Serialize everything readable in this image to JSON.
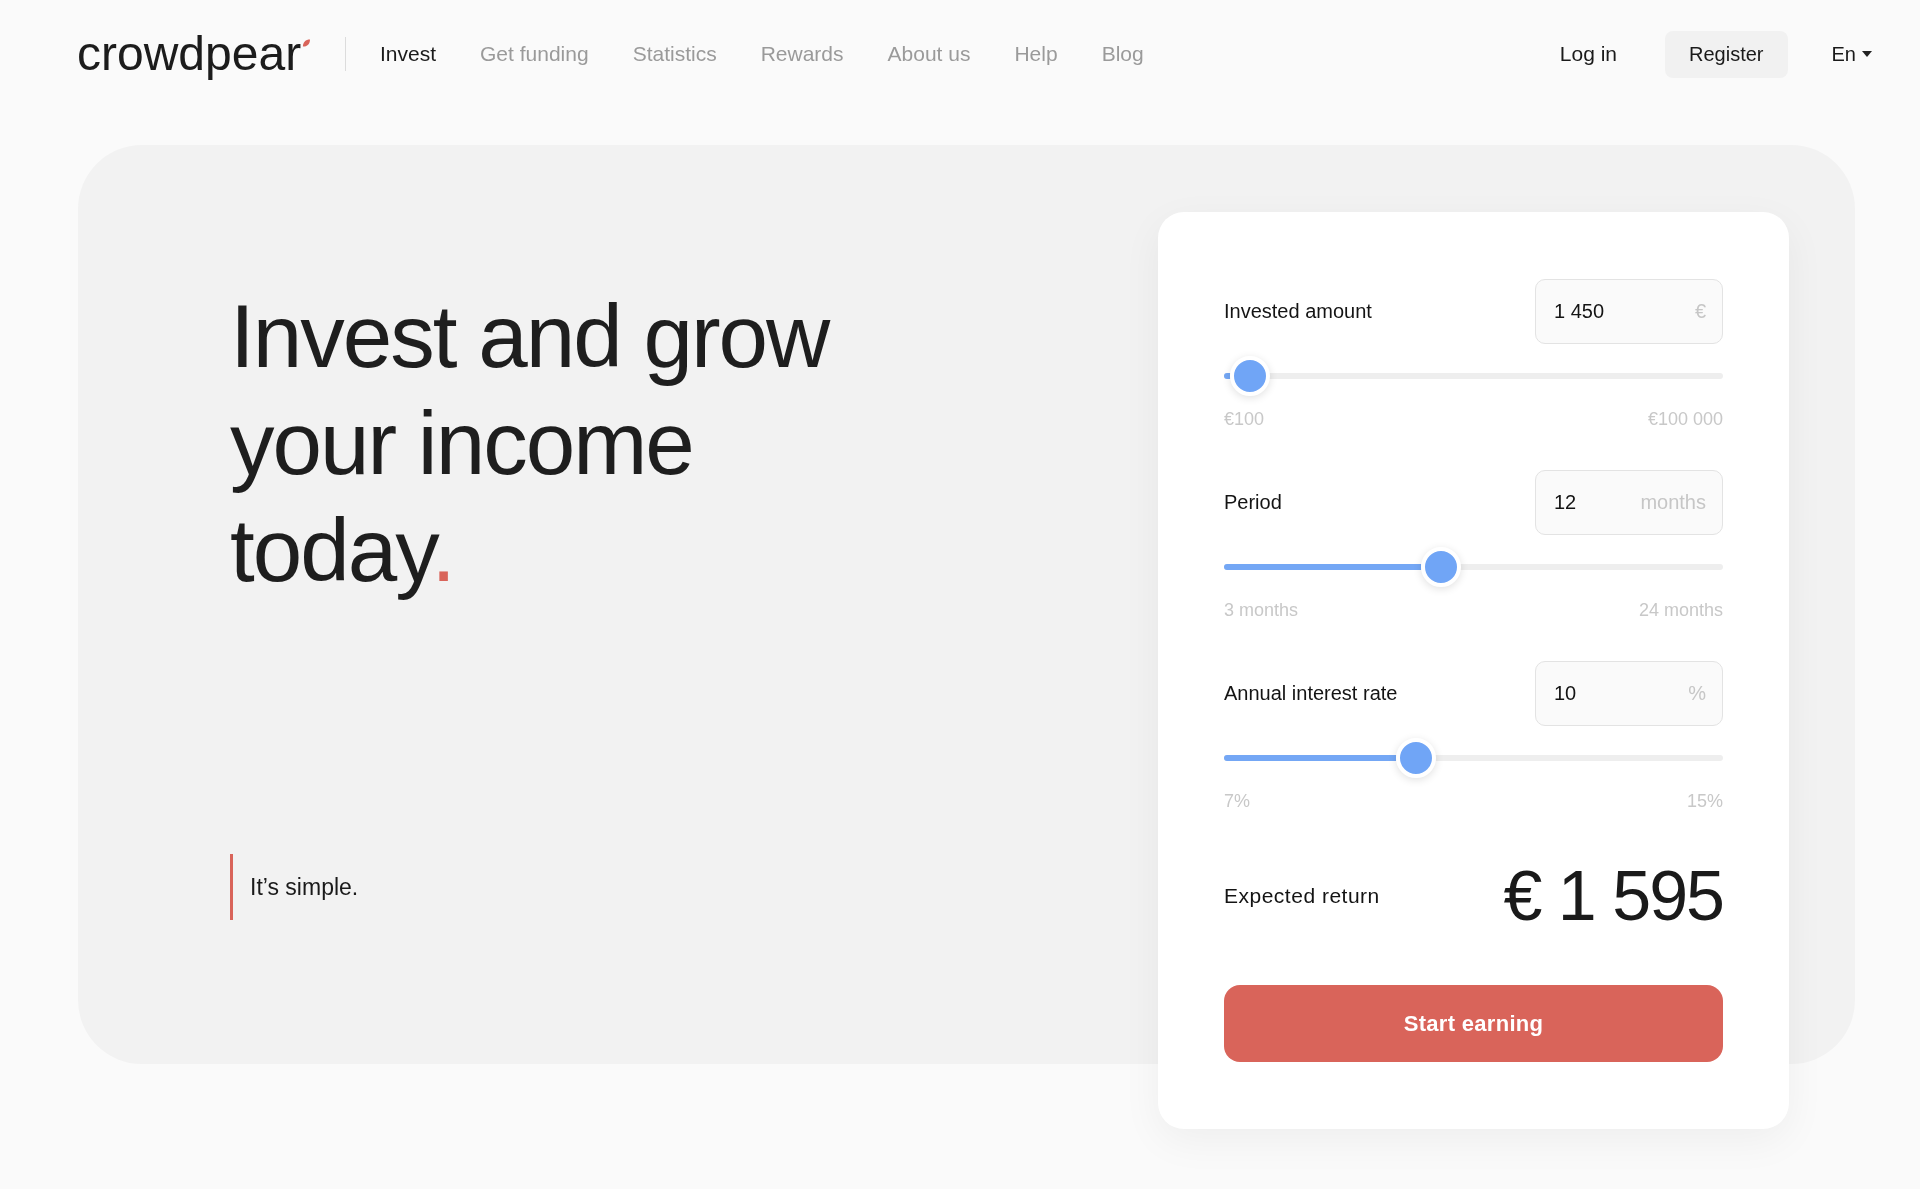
{
  "header": {
    "logo": "crowdpear",
    "nav": [
      {
        "label": "Invest",
        "selected": true
      },
      {
        "label": "Get funding",
        "selected": false
      },
      {
        "label": "Statistics",
        "selected": false
      },
      {
        "label": "Rewards",
        "selected": false
      },
      {
        "label": "About us",
        "selected": false
      },
      {
        "label": "Help",
        "selected": false
      },
      {
        "label": "Blog",
        "selected": false
      }
    ],
    "login": "Log in",
    "register": "Register",
    "language": "En"
  },
  "hero": {
    "headline": "Invest and grow your income today",
    "headline_end": ".",
    "tagline": "It’s simple."
  },
  "calculator": {
    "fields": [
      {
        "label": "Invested amount",
        "value": "1 450",
        "unit": "€",
        "level": 0.014,
        "min_label": "€100",
        "max_label": "€100 000"
      },
      {
        "label": "Period",
        "value": "12",
        "unit": "months",
        "level": 0.429,
        "min_label": "3 months",
        "max_label": "24 months"
      },
      {
        "label": "Annual interest rate",
        "value": "10",
        "unit": "%",
        "level": 0.375,
        "min_label": "7%",
        "max_label": "15%"
      }
    ],
    "result_label": "Expected return",
    "result_value": "€ 1 595",
    "button": "Start earning"
  }
}
